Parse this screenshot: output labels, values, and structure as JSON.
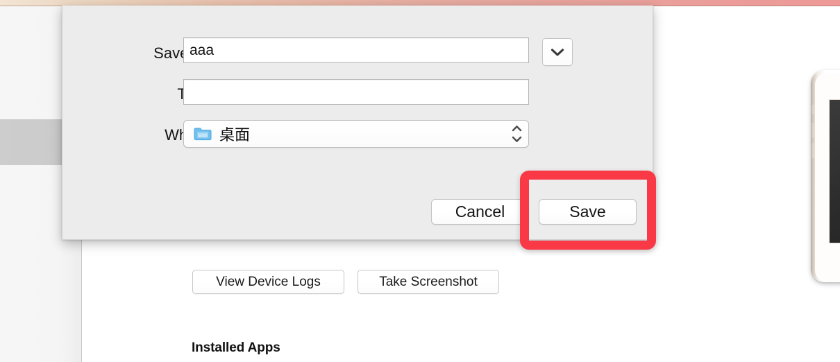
{
  "window": {
    "titlebar_gradient_start": "#f3e4d4",
    "titlebar_gradient_end": "#ee9a97"
  },
  "sidebar": {
    "selected_row_color": "#cbcbcb",
    "background_color": "#f5f5f5"
  },
  "device_panel": {
    "buttons": [
      {
        "name": "view-device-logs",
        "label": "View Device Logs"
      },
      {
        "name": "take-screenshot",
        "label": "Take Screenshot"
      }
    ],
    "installed_apps_heading": "Installed Apps",
    "device_preview_icon": "iphone-device-icon"
  },
  "save_dialog": {
    "fields": {
      "save_as": {
        "label": "Save As:",
        "value": "aaa",
        "placeholder": ""
      },
      "tags": {
        "label": "Tags:",
        "value": "",
        "placeholder": ""
      },
      "where": {
        "label": "Where:",
        "value": "桌面",
        "folder_icon": "blue-folder-icon",
        "stepper_icon": "up-down-chevron-icon"
      }
    },
    "expand_button_icon": "chevron-down-icon",
    "buttons": {
      "cancel": "Cancel",
      "save": "Save"
    },
    "background_color": "#ececec"
  },
  "annotation": {
    "highlight_target": "save-button",
    "highlight_color": "#fa3946",
    "border_width_px": 13
  }
}
